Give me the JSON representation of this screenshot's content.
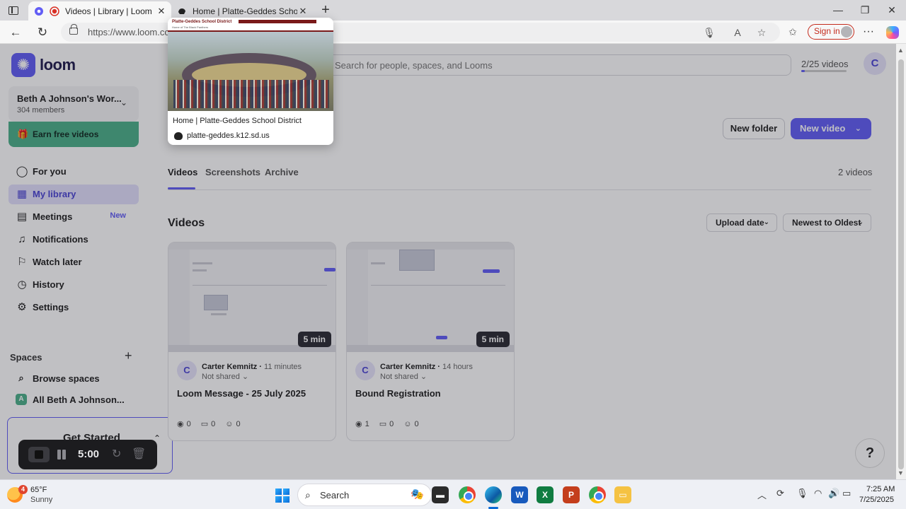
{
  "browser": {
    "tabs": [
      {
        "title": "Videos | Library | Loom",
        "active": true
      },
      {
        "title": "Home | Platte-Geddes School Dis",
        "active": false
      }
    ],
    "url": "https://www.loom.com",
    "signin_label": "Sign in"
  },
  "tab_preview": {
    "site_name": "Platte-Geddes School District",
    "site_tagline": "Home of The Black Panthers",
    "title": "Home | Platte-Geddes School District",
    "domain": "platte-geddes.k12.sd.us"
  },
  "loom": {
    "logo_text": "loom",
    "workspace": {
      "name": "Beth A Johnson's Wor...",
      "members": "304 members"
    },
    "earn_label": "Earn free videos",
    "nav": [
      {
        "label": "For you",
        "icon": "user-icon"
      },
      {
        "label": "My library",
        "icon": "library-icon",
        "active": true
      },
      {
        "label": "Meetings",
        "icon": "calendar-icon",
        "badge": "New"
      },
      {
        "label": "Notifications",
        "icon": "bell-icon"
      },
      {
        "label": "Watch later",
        "icon": "bookmark-icon"
      },
      {
        "label": "History",
        "icon": "history-icon"
      },
      {
        "label": "Settings",
        "icon": "gear-icon"
      }
    ],
    "spaces": {
      "header": "Spaces",
      "items": [
        {
          "label": "Browse spaces",
          "icon": "search-icon"
        },
        {
          "label": "All Beth A Johnson...",
          "letter": "A"
        }
      ]
    },
    "get_started": "Get Started",
    "search_placeholder": "Search for people, spaces, and Looms",
    "quota": {
      "label": "2/25 videos",
      "used": 2,
      "limit": 25
    },
    "user_initial": "C",
    "buttons": {
      "new_folder": "New folder",
      "new_video": "New video"
    },
    "subtabs": [
      "Videos",
      "Screenshots",
      "Archive"
    ],
    "video_count": "2 videos",
    "section_title": "Videos",
    "sort": {
      "field": "Upload date",
      "order": "Newest to Oldest"
    },
    "videos": [
      {
        "title": "Loom Message - 25 July 2025",
        "author": "Carter Kemnitz",
        "ago": "11 minutes",
        "shared": "Not shared",
        "duration": "5 min",
        "views": "0",
        "comments": "0",
        "reactions": "0"
      },
      {
        "title": "Bound Registration",
        "author": "Carter Kemnitz",
        "ago": "14 hours",
        "shared": "Not shared",
        "duration": "5 min",
        "views": "1",
        "comments": "0",
        "reactions": "0"
      }
    ],
    "help_label": "?"
  },
  "recorder": {
    "time": "5:00"
  },
  "taskbar": {
    "weather": {
      "temp": "65°F",
      "condition": "Sunny",
      "badge": "4"
    },
    "search_label": "Search",
    "time": "7:25 AM",
    "date": "7/25/2025"
  }
}
